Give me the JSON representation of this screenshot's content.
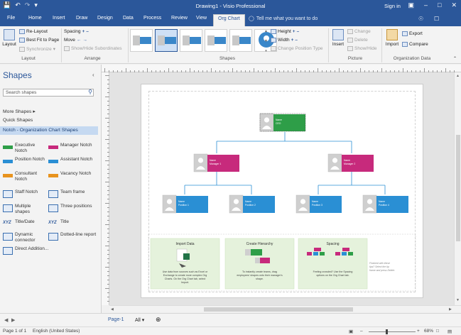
{
  "titlebar": {
    "title": "Drawing1 - Visio Professional",
    "signin": "Sign in",
    "qat": [
      "save-icon",
      "undo-icon",
      "redo-icon",
      "customize-qat-icon"
    ],
    "window_controls": [
      "ribbon-display-icon",
      "minimize-icon",
      "maximize-icon",
      "close-icon"
    ]
  },
  "tabs": {
    "items": [
      "File",
      "Home",
      "Insert",
      "Draw",
      "Design",
      "Data",
      "Process",
      "Review",
      "View",
      "Org Chart"
    ],
    "active": "Org Chart",
    "tell_me": "Tell me what you want to do",
    "right_icons": [
      "share-icon",
      "comments-icon"
    ]
  },
  "ribbon": {
    "layout": {
      "group_label": "Layout",
      "layout_button": "Layout",
      "re_layout": "Re-Layout",
      "best_fit": "Best Fit to Page",
      "synchronize": "Synchronize"
    },
    "arrange": {
      "group_label": "Arrange",
      "spacing": "Spacing",
      "move": "Move",
      "show_hide_subordinates": "Show/Hide Subordinates"
    },
    "shapes": {
      "group_label": "Shapes",
      "height": "Height",
      "width": "Width",
      "change_position_type": "Change Position Type"
    },
    "picture": {
      "group_label": "Picture",
      "insert": "Insert",
      "change": "Change",
      "delete": "Delete",
      "show_hide": "Show/Hide"
    },
    "org_data": {
      "group_label": "Organization Data",
      "import": "Import",
      "export": "Export",
      "compare": "Compare"
    }
  },
  "shapes_pane": {
    "title": "Shapes",
    "search_placeholder": "Search shapes",
    "more_shapes": "More Shapes",
    "quick_shapes": "Quick Shapes",
    "stencil": "Notch - Organization Chart Shapes",
    "masters": [
      {
        "label": "Executive Notch",
        "color": "#2e9e48",
        "icon": "executive-notch-icon"
      },
      {
        "label": "Manager Notch",
        "color": "#c72a7c",
        "icon": "manager-notch-icon"
      },
      {
        "label": "Position Notch",
        "color": "#2a8fd4",
        "icon": "position-notch-icon"
      },
      {
        "label": "Assistant Notch",
        "color": "#2a8fd4",
        "icon": "assistant-notch-icon"
      },
      {
        "label": "Consultant Notch",
        "color": "#e8931e",
        "icon": "consultant-notch-icon"
      },
      {
        "label": "Vacancy Notch",
        "color": "#e8931e",
        "icon": "vacancy-notch-icon"
      },
      {
        "label": "Staff Notch",
        "color": "#2b579a",
        "icon": "staff-notch-icon"
      },
      {
        "label": "Team frame",
        "color": "#2b579a",
        "icon": "team-frame-icon"
      },
      {
        "label": "Multiple shapes",
        "color": "#2b579a",
        "icon": "multiple-shapes-icon"
      },
      {
        "label": "Three positions",
        "color": "#2b579a",
        "icon": "three-positions-icon"
      },
      {
        "label": "Title/Date",
        "color": "#2b579a",
        "icon": "title-date-icon",
        "glyph": "XYZ"
      },
      {
        "label": "Title",
        "color": "#2b579a",
        "icon": "title-icon",
        "glyph": "XYZ"
      },
      {
        "label": "Dynamic connector",
        "color": "#2b579a",
        "icon": "dynamic-connector-icon"
      },
      {
        "label": "Dotted-line report",
        "color": "#2b579a",
        "icon": "dotted-line-report-icon"
      },
      {
        "label": "Direct Addition...",
        "color": "#2b579a",
        "icon": "direct-addition-icon"
      }
    ]
  },
  "orgchart": {
    "colors": {
      "executive": "#2e9e48",
      "manager": "#c72a7c",
      "position": "#2a8fd4",
      "connector": "#2a8fd4"
    },
    "executive": {
      "name": "Name",
      "title": "CEO"
    },
    "managers": [
      {
        "name": "Name",
        "title": "Manager 1"
      },
      {
        "name": "Name",
        "title": "Manager 2"
      }
    ],
    "positions": [
      {
        "name": "Name",
        "title": "Position 1"
      },
      {
        "name": "Name",
        "title": "Position 2"
      },
      {
        "name": "Name",
        "title": "Position 3"
      },
      {
        "name": "Name",
        "title": "Position 4"
      }
    ]
  },
  "help_panels": [
    {
      "title": "Import Data",
      "text": "Use data from sources such as Excel or Exchange to create more complex Org Charts. On the Org Chart tab, select Import."
    },
    {
      "title": "Create Hierarchy",
      "text": "To instantly create teams, drag employees' shapes onto their manager's shape."
    },
    {
      "title": "Spacing",
      "text": "Feeling crowded? Use the Spacing options on the Org Chart tab."
    }
  ],
  "help_note": "Finished with these tips? Select the tip frame and press Delete.",
  "pagetabs": {
    "page": "Page-1",
    "all": "All",
    "add_icon": "add-page-icon"
  },
  "status": {
    "page": "Page 1 of 1",
    "language": "English (United States)",
    "zoom": "68%"
  }
}
